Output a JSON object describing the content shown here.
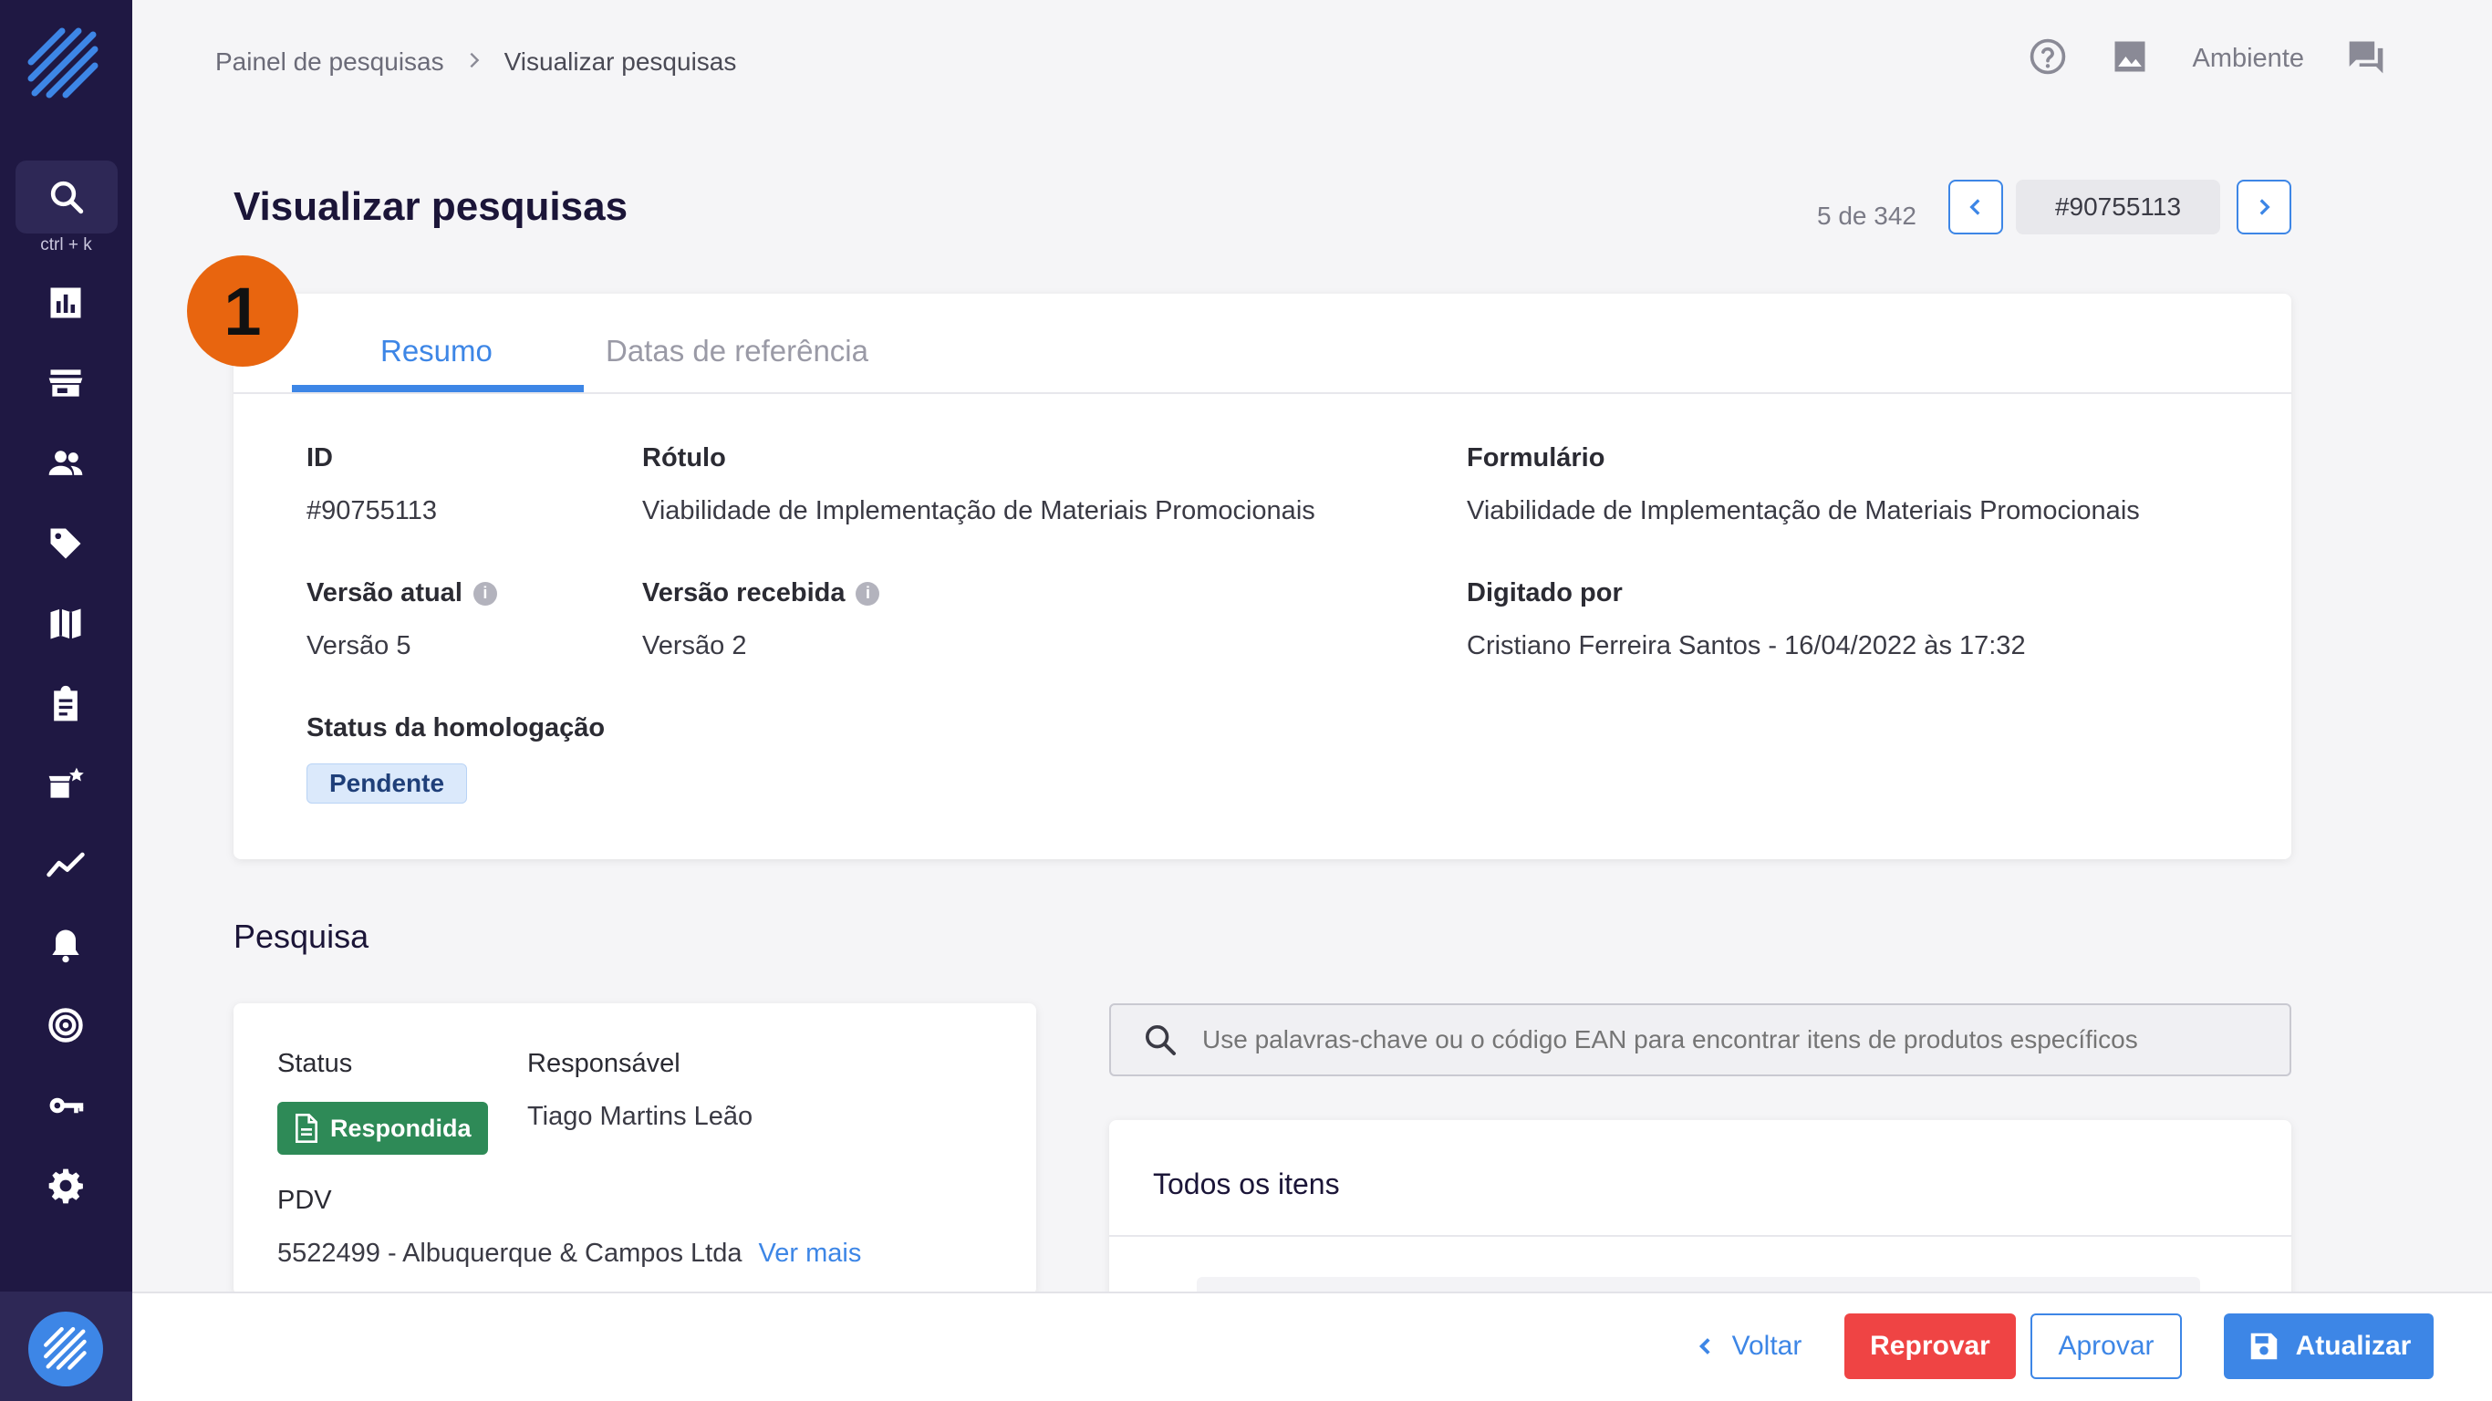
{
  "sidebar": {
    "shortcut": "ctrl + k",
    "icons": [
      "search-icon",
      "bar-chart-icon",
      "store-icon",
      "people-icon",
      "tag-icon",
      "map-icon",
      "clipboard-icon",
      "store-star-icon",
      "trend-icon",
      "bell-icon",
      "target-icon",
      "key-icon",
      "gear-icon"
    ]
  },
  "breadcrumb": {
    "item1": "Painel de pesquisas",
    "item2": "Visualizar pesquisas"
  },
  "topbar": {
    "environment": "Ambiente"
  },
  "page": {
    "title": "Visualizar pesquisas",
    "pager_count": "5 de 342",
    "current_id": "#90755113"
  },
  "annotation": {
    "number": "1"
  },
  "tabs": {
    "summary": "Resumo",
    "reference_dates": "Datas de referência"
  },
  "summary": {
    "id_label": "ID",
    "id_value": "#90755113",
    "label_label": "Rótulo",
    "label_value": "Viabilidade de Implementação de Materiais Promocionais",
    "form_label": "Formulário",
    "form_value": "Viabilidade de Implementação de Materiais Promocionais",
    "current_version_label": "Versão atual",
    "current_version_value": "Versão 5",
    "received_version_label": "Versão recebida",
    "received_version_value": "Versão 2",
    "typed_by_label": "Digitado por",
    "typed_by_value": "Cristiano Ferreira Santos - 16/04/2022 às 17:32",
    "approval_status_label": "Status da homologação",
    "approval_status_value": "Pendente"
  },
  "survey": {
    "section_title": "Pesquisa",
    "status_label": "Status",
    "status_value": "Respondida",
    "responsible_label": "Responsável",
    "responsible_value": "Tiago Martins Leão",
    "pdv_label": "PDV",
    "pdv_value": "5522499 - Albuquerque & Campos Ltda",
    "see_more": "Ver mais",
    "search_placeholder": "Use palavras-chave ou o código EAN para encontrar itens de produtos específicos",
    "all_items_title": "Todos os itens"
  },
  "footer": {
    "back": "Voltar",
    "reject": "Reprovar",
    "approve": "Aprovar",
    "update": "Atualizar"
  },
  "colors": {
    "sidebar": "#1f1843",
    "accent": "#3d86e6",
    "reject": "#ef4444",
    "success": "#2e8a57",
    "annotation": "#e8650f"
  }
}
